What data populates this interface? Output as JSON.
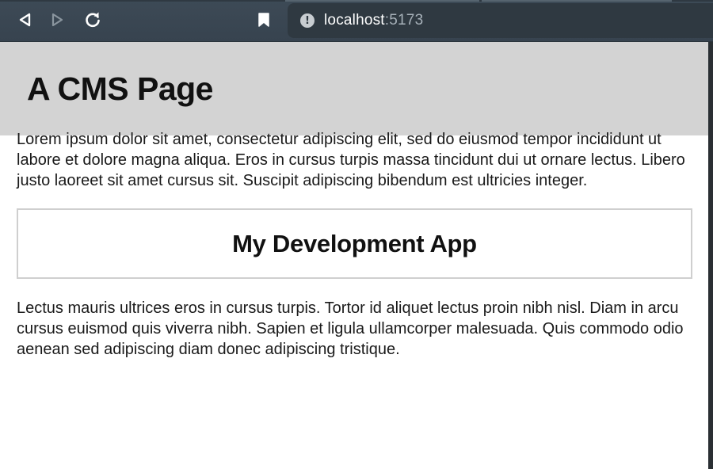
{
  "browser": {
    "url_host": "localhost",
    "url_port": ":5173",
    "icons": [
      "back-icon",
      "forward-icon",
      "reload-icon",
      "bookmark-icon",
      "site-info-icon"
    ],
    "site_info_glyph": "!"
  },
  "page": {
    "header_title": "A CMS Page",
    "paragraph_1": "Lorem ipsum dolor sit amet, consectetur adipiscing elit, sed do eiusmod tempor incididunt ut labore et dolore magna aliqua. Eros in cursus turpis massa tincidunt dui ut ornare lectus. Libero justo laoreet sit amet cursus sit. Suscipit adipiscing bibendum est ultricies integer.",
    "app_title": "My Development App",
    "paragraph_2": "Lectus mauris ultrices eros in cursus turpis. Tortor id aliquet lectus proin nibh nisl. Diam in arcu cursus euismod quis viverra nibh. Sapien et ligula ullamcorper malesuada. Quis commodo odio aenean sed adipiscing diam donec adipiscing tristique."
  },
  "colors": {
    "browser_bar": "#3d4a56",
    "address_bar": "#2f3941",
    "header_bg": "#d3d3d3",
    "app_box_border": "#cfcfcf"
  }
}
